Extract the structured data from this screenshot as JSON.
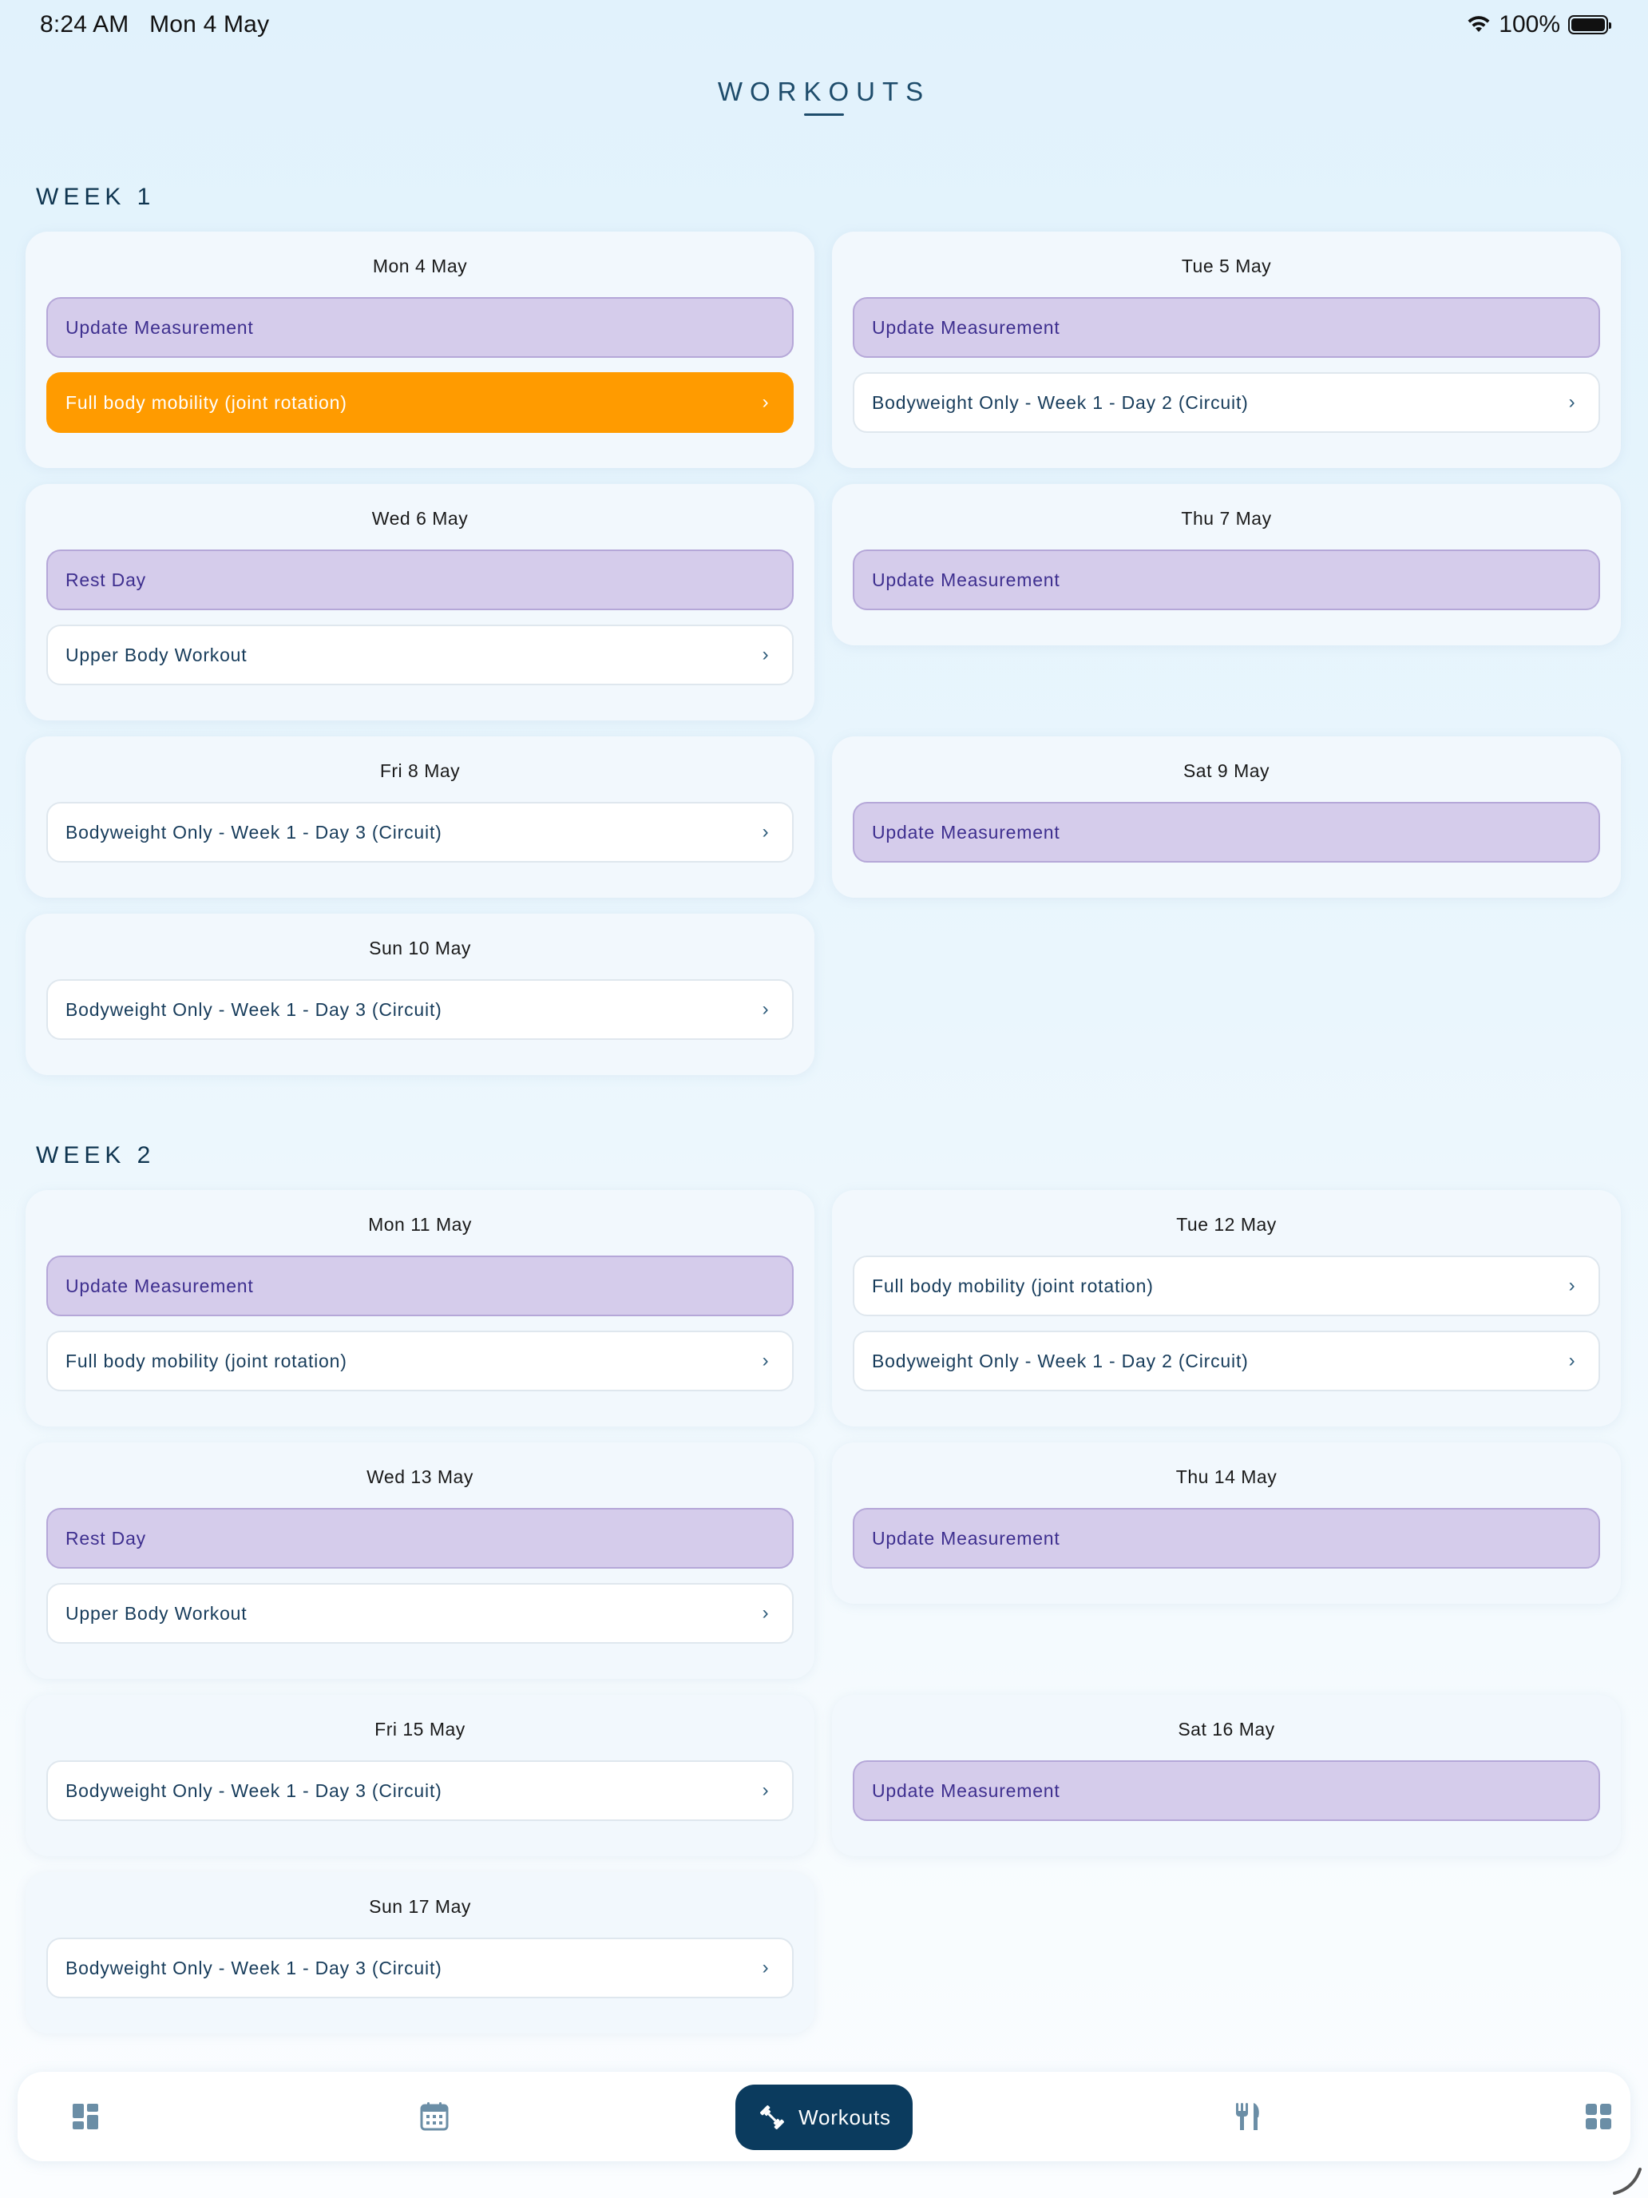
{
  "status_bar": {
    "time": "8:24 AM",
    "date": "Mon 4 May",
    "battery": "100%"
  },
  "page_title": "WORKOUTS",
  "weeks": [
    {
      "label": "WEEK 1",
      "days": [
        {
          "title": "Mon 4 May",
          "items": [
            {
              "label": "Update Measurement",
              "style": "purple"
            },
            {
              "label": "Full body mobility (joint rotation)",
              "style": "orange",
              "chevron": true
            }
          ]
        },
        {
          "title": "Tue 5 May",
          "items": [
            {
              "label": "Update Measurement",
              "style": "purple"
            },
            {
              "label": "Bodyweight Only - Week 1 - Day 2 (Circuit)",
              "style": "white",
              "chevron": true
            }
          ]
        },
        {
          "title": "Wed 6 May",
          "items": [
            {
              "label": "Rest Day",
              "style": "purple"
            },
            {
              "label": "Upper Body Workout",
              "style": "white",
              "chevron": true
            }
          ]
        },
        {
          "title": "Thu 7 May",
          "items": [
            {
              "label": "Update Measurement",
              "style": "purple"
            }
          ]
        },
        {
          "title": "Fri 8 May",
          "items": [
            {
              "label": "Bodyweight Only - Week 1 - Day 3 (Circuit)",
              "style": "white",
              "chevron": true
            }
          ]
        },
        {
          "title": "Sat 9 May",
          "items": [
            {
              "label": "Update Measurement",
              "style": "purple"
            }
          ]
        },
        {
          "title": "Sun 10 May",
          "items": [
            {
              "label": "Bodyweight Only - Week 1 - Day 3 (Circuit)",
              "style": "white",
              "chevron": true
            }
          ]
        }
      ]
    },
    {
      "label": "WEEK 2",
      "days": [
        {
          "title": "Mon 11 May",
          "items": [
            {
              "label": "Update Measurement",
              "style": "purple"
            },
            {
              "label": "Full body mobility (joint rotation)",
              "style": "white",
              "chevron": true
            }
          ]
        },
        {
          "title": "Tue 12 May",
          "items": [
            {
              "label": "Full body mobility (joint rotation)",
              "style": "white",
              "chevron": true
            },
            {
              "label": "Bodyweight Only - Week 1 - Day 2 (Circuit)",
              "style": "white",
              "chevron": true
            }
          ]
        },
        {
          "title": "Wed 13 May",
          "items": [
            {
              "label": "Rest Day",
              "style": "purple"
            },
            {
              "label": "Upper Body Workout",
              "style": "white",
              "chevron": true
            }
          ]
        },
        {
          "title": "Thu 14 May",
          "items": [
            {
              "label": "Update Measurement",
              "style": "purple"
            }
          ]
        },
        {
          "title": "Fri 15 May",
          "items": [
            {
              "label": "Bodyweight Only - Week 1 - Day 3 (Circuit)",
              "style": "white",
              "chevron": true
            }
          ]
        },
        {
          "title": "Sat 16 May",
          "items": [
            {
              "label": "Update Measurement",
              "style": "purple"
            }
          ]
        },
        {
          "title": "Sun 17 May",
          "items": [
            {
              "label": "Bodyweight Only - Week 1 - Day 3 (Circuit)",
              "style": "white",
              "chevron": true
            }
          ]
        }
      ]
    }
  ],
  "bottom_nav": {
    "items": [
      {
        "icon": "dashboard-icon"
      },
      {
        "icon": "calendar-icon"
      },
      {
        "icon": "dumbbell-icon",
        "label": "Workouts",
        "active": true
      },
      {
        "icon": "fork-knife-icon"
      },
      {
        "icon": "grid-apps-icon"
      }
    ]
  },
  "colors": {
    "accent_dark": "#0b3b5e",
    "highlight_orange": "#ff9b00",
    "purple_item": "#d5cceb",
    "background": "#e1f2fc"
  }
}
